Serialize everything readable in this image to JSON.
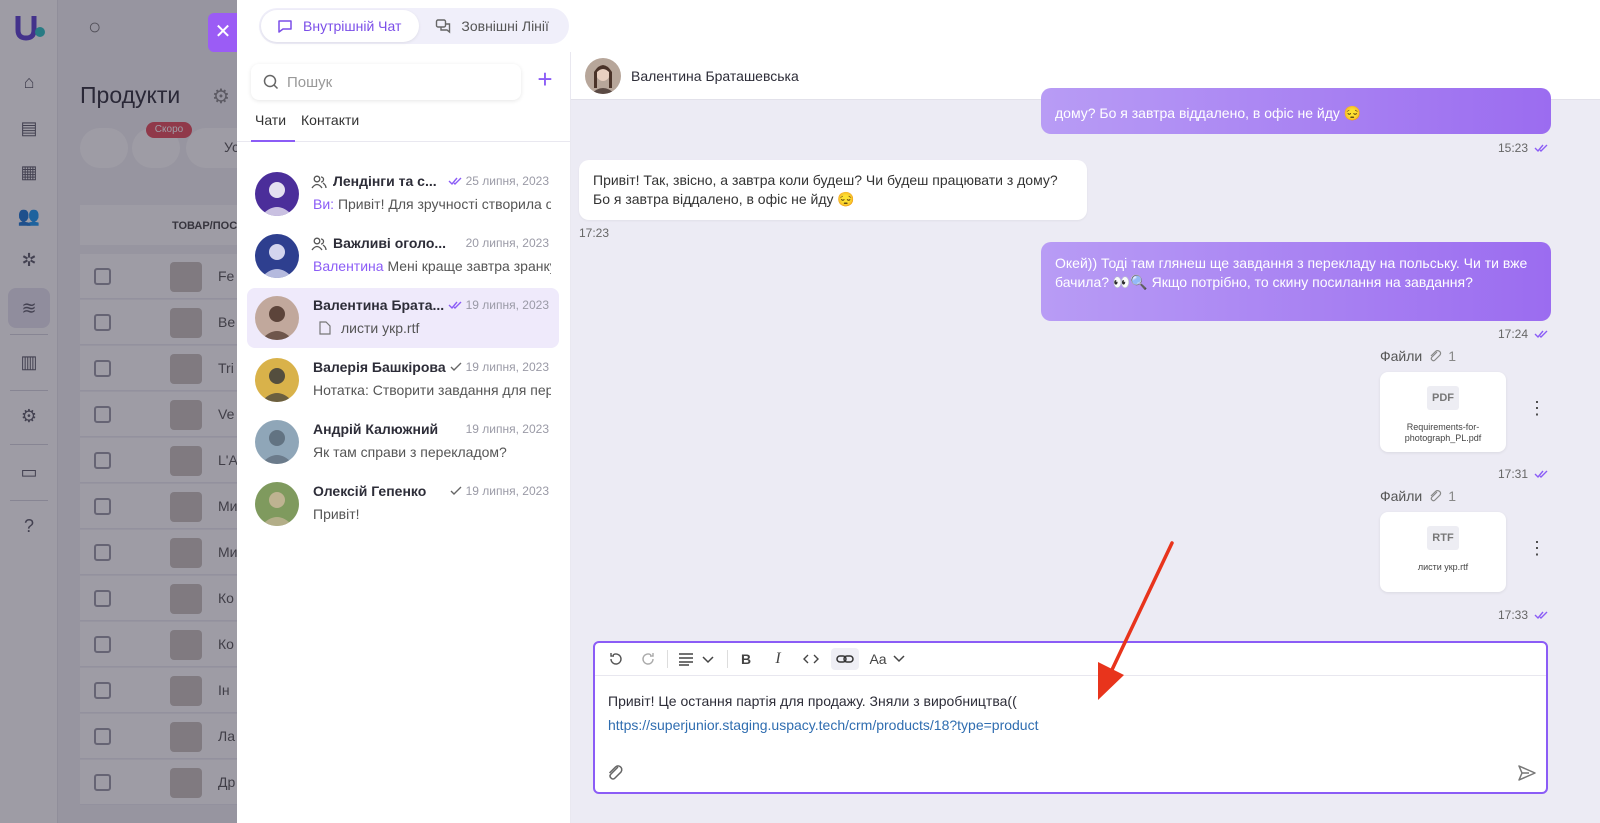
{
  "background": {
    "title": "Продукти",
    "badge": "Скоро",
    "filter_label": "Ус",
    "table_header": "ТОВАР/ПОС",
    "rows": [
      "Fe",
      "Be",
      "Tri",
      "Ve",
      "L'A",
      "Ми",
      "Ми",
      "Ко",
      "Ко",
      "Ін",
      "Ла",
      "Др"
    ]
  },
  "header_tabs": [
    {
      "label": "Внутрішній Чат",
      "active": true
    },
    {
      "label": "Зовнішні Лінії",
      "active": false
    }
  ],
  "search": {
    "placeholder": "Пошук"
  },
  "list_tabs": [
    {
      "label": "Чати",
      "active": true
    },
    {
      "label": "Контакти",
      "active": false
    }
  ],
  "chats": [
    {
      "name": "Лендінги та с...",
      "date": "25 липня, 2023",
      "who": "Ви:",
      "preview": " Привіт! Для зручності створила о",
      "group": true,
      "read": "double"
    },
    {
      "name": "Важливі оголо...",
      "date": "20 липня, 2023",
      "who": "Валентина",
      "preview": " Мені краще завтра зранку",
      "group": true,
      "read": "none"
    },
    {
      "name": "Валентина Брата...",
      "date": "19 липня, 2023",
      "who": "",
      "preview": "листи укр.rtf",
      "group": false,
      "read": "double"
    },
    {
      "name": "Валерія Башкірова",
      "date": "19 липня, 2023",
      "who": "",
      "preview": "Нотатка: Створити завдання для пер",
      "group": false,
      "read": "single"
    },
    {
      "name": "Андрій Калюжний",
      "date": "19 липня, 2023",
      "who": "",
      "preview": "Як там справи з перекладом?",
      "group": false,
      "read": "none"
    },
    {
      "name": "Олексій Гепенко",
      "date": "19 липня, 2023",
      "who": "",
      "preview": "Привіт!",
      "group": false,
      "read": "single"
    }
  ],
  "conversation": {
    "contact": "Валентина Браташевська",
    "messages": [
      {
        "dir": "out",
        "text": "дому? Бо я завтра віддалено, в офіс не йду 😔",
        "time": "15:23"
      },
      {
        "dir": "in",
        "text": "Привіт! Так, звісно, а завтра коли будеш? Чи будеш працювати з дому? Бо я завтра віддалено, в офіс не йду 😔",
        "time": "17:23"
      },
      {
        "dir": "out",
        "text": "Окей)) Тоді там глянеш ще завдання з перекладу на польську. Чи ти вже бачила? 👀🔍 Якщо потрібно, то скину посилання на завдання?",
        "time": "17:24"
      }
    ],
    "files": [
      {
        "label": "Файли",
        "count": "1",
        "ext": "PDF",
        "name": "Requirements-for-photograph_PL.pdf",
        "time": "17:31"
      },
      {
        "label": "Файли",
        "count": "1",
        "ext": "RTF",
        "name": "листи укр.rtf",
        "time": "17:33"
      }
    ]
  },
  "composer": {
    "text": "Привіт! Це остання партія для продажу. Зняли з виробництва((",
    "link": "https://superjunior.staging.uspacy.tech/crm/products/18?type=product",
    "format_label": "Aa"
  },
  "colors": {
    "accent": "#8b5cf6",
    "annotation": "#e8341c"
  }
}
